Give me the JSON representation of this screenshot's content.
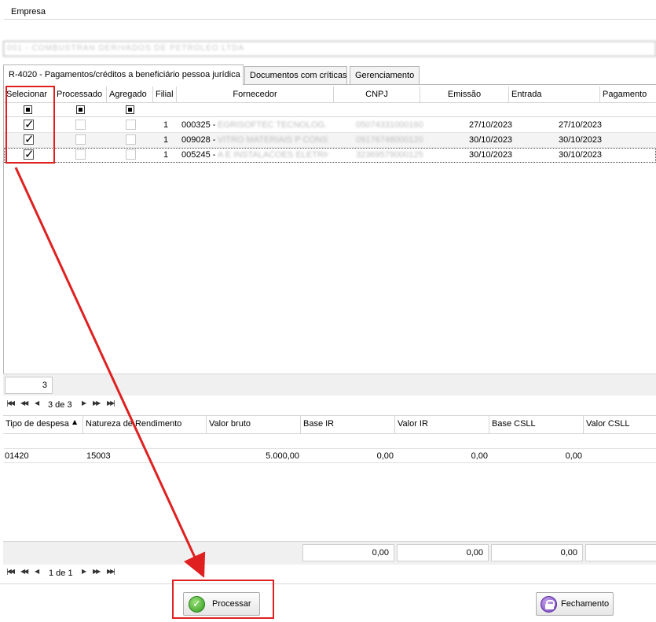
{
  "empresa": {
    "label": "Empresa",
    "value": "001 - COMBUSTRAN DERIVADOS DE PETROLEO LTDA"
  },
  "tabs": [
    {
      "label": "R-4020 - Pagamentos/créditos a beneficiário pessoa jurídica",
      "active": true
    },
    {
      "label": "Documentos com críticas",
      "active": false
    },
    {
      "label": "Gerenciamento",
      "active": false
    }
  ],
  "grid": {
    "columns": [
      "Selecionar",
      "Processado",
      "Agregado",
      "Filial",
      "Fornecedor",
      "CNPJ",
      "Emissão",
      "Entrada",
      "Pagamento"
    ],
    "rows": [
      {
        "selecionar": true,
        "processado": false,
        "agregado": false,
        "filial": "1",
        "fornecedor_code": "000325 -",
        "fornecedor_name": "EGRISOFTEC TECNOLOG...",
        "cnpj": "05074331000160",
        "emissao": "27/10/2023",
        "entrada": "27/10/2023",
        "pagamento": ""
      },
      {
        "selecionar": true,
        "processado": false,
        "agregado": false,
        "filial": "1",
        "fornecedor_code": "009028 -",
        "fornecedor_name": "VITRO MATERIAIS P CONS...",
        "cnpj": "09176748000120",
        "emissao": "30/10/2023",
        "entrada": "30/10/2023",
        "pagamento": ""
      },
      {
        "selecionar": true,
        "processado": false,
        "agregado": false,
        "filial": "1",
        "fornecedor_code": "005245 -",
        "fornecedor_name": "A E INSTALACOES ELETRIC...",
        "cnpj": "32369579000125",
        "emissao": "30/10/2023",
        "entrada": "30/10/2023",
        "pagamento": ""
      }
    ],
    "count": "3",
    "nav_text": "3 de 3"
  },
  "detail": {
    "columns": [
      "Tipo de despesa",
      "Natureza de Rendimento",
      "Valor bruto",
      "Base IR",
      "Valor IR",
      "Base CSLL",
      "Valor CSLL"
    ],
    "row": {
      "tipo": "01420",
      "natureza": "15003",
      "valor_bruto": "5.000,00",
      "base_ir": "0,00",
      "valor_ir": "0,00",
      "base_csll": "0,00"
    },
    "totals": [
      "0,00",
      "0,00",
      "0,00"
    ],
    "nav_text": "1 de 1"
  },
  "buttons": {
    "processar": "Processar",
    "fechamento": "Fechamento"
  },
  "colors": {
    "annotation_red": "#e02020",
    "border": "#b5b5b5"
  }
}
